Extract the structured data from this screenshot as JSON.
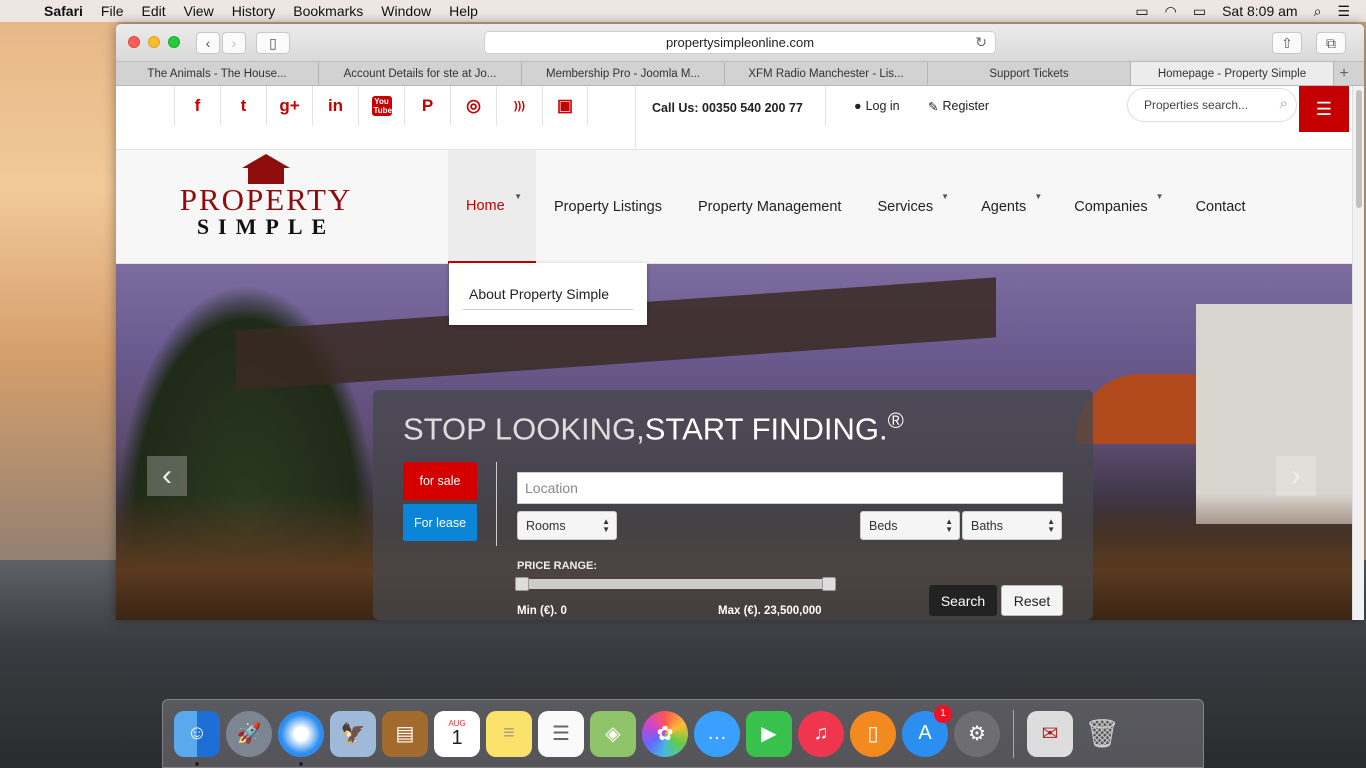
{
  "menubar": {
    "apple": "",
    "app_name": "Safari",
    "menus": [
      "File",
      "Edit",
      "View",
      "History",
      "Bookmarks",
      "Window",
      "Help"
    ],
    "clock": "Sat 8:09 am"
  },
  "browser": {
    "url": "propertysimpleonline.com",
    "tabs": [
      {
        "label": "The Animals - The House..."
      },
      {
        "label": "Account Details for ste at Jo..."
      },
      {
        "label": "Membership Pro - Joomla M..."
      },
      {
        "label": "XFM Radio Manchester - Lis..."
      },
      {
        "label": "Support Tickets"
      },
      {
        "label": "Homepage - Property Simple"
      }
    ]
  },
  "topbar": {
    "socials": [
      {
        "icon": "facebook-icon",
        "glyph": "f"
      },
      {
        "icon": "twitter-icon",
        "glyph": "t"
      },
      {
        "icon": "google-plus-icon",
        "glyph": "g+"
      },
      {
        "icon": "linkedin-icon",
        "glyph": "in"
      },
      {
        "icon": "youtube-icon",
        "glyph": "You Tube"
      },
      {
        "icon": "pinterest-icon",
        "glyph": "P"
      },
      {
        "icon": "dribbble-icon",
        "glyph": "◎"
      },
      {
        "icon": "rss-icon",
        "glyph": ")))"
      },
      {
        "icon": "instagram-icon",
        "glyph": "▣"
      }
    ],
    "call_us": "Call Us: 00350 540 200 77",
    "login": "Log in",
    "register": "Register",
    "search_placeholder": "Properties search..."
  },
  "logo": {
    "line1": "PROPERTY",
    "line2": "SIMPLE"
  },
  "nav": {
    "items": [
      {
        "label": "Home",
        "active": true,
        "caret": true
      },
      {
        "label": "Property Listings",
        "active": false,
        "caret": false
      },
      {
        "label": "Property Management",
        "active": false,
        "caret": false
      },
      {
        "label": "Services",
        "active": false,
        "caret": true
      },
      {
        "label": "Agents",
        "active": false,
        "caret": true
      },
      {
        "label": "Companies",
        "active": false,
        "caret": true
      },
      {
        "label": "Contact",
        "active": false,
        "caret": false
      }
    ],
    "dropdown_item": "About Property Simple"
  },
  "hero": {
    "headline_light": "STOP LOOKING,",
    "headline_bold": "START FINDING.",
    "headline_mark": "®",
    "for_sale": "for sale",
    "for_lease": "For lease",
    "location_placeholder": "Location",
    "rooms": "Rooms",
    "beds": "Beds",
    "baths": "Baths",
    "price_range_label": "PRICE RANGE:",
    "min_label": "Min (€). 0",
    "max_label": "Max (€). 23,500,000",
    "search": "Search",
    "reset": "Reset"
  },
  "dock": {
    "calendar_month": "AUG",
    "calendar_day": "1",
    "appstore_badge": "1"
  },
  "colors": {
    "brand_red": "#c50000",
    "lease_blue": "#0a85d8"
  }
}
